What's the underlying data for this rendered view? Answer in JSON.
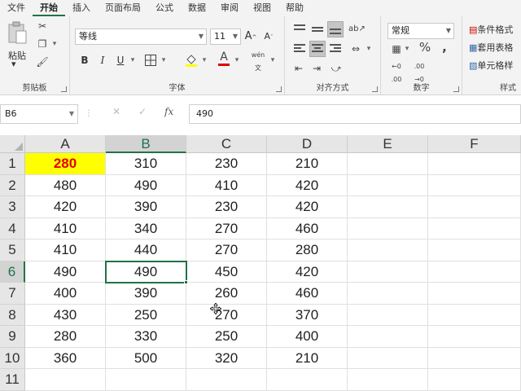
{
  "menu": {
    "tabs": [
      "文件",
      "开始",
      "插入",
      "页面布局",
      "公式",
      "数据",
      "审阅",
      "视图",
      "帮助"
    ],
    "active_index": 1
  },
  "ribbon": {
    "clipboard": {
      "label": "剪贴板",
      "paste_label": "粘贴"
    },
    "font": {
      "label": "字体",
      "font_name": "等线",
      "font_size": "11",
      "grow": "A",
      "shrink": "A",
      "bold": "B",
      "italic": "I",
      "underline": "U",
      "phonetic": "wén"
    },
    "alignment": {
      "label": "对齐方式"
    },
    "number": {
      "label": "数字",
      "format": "常规",
      "percent": "%"
    },
    "styles": {
      "label": "样式",
      "conditional": "条件格式",
      "table": "套用表格",
      "cell": "单元格样"
    }
  },
  "formula_bar": {
    "name_box": "B6",
    "fx": "fx",
    "formula": "490"
  },
  "sheet": {
    "columns": [
      "A",
      "B",
      "C",
      "D",
      "E",
      "F"
    ],
    "rows": [
      [
        "280",
        "310",
        "230",
        "210",
        "",
        ""
      ],
      [
        "480",
        "490",
        "410",
        "420",
        "",
        ""
      ],
      [
        "420",
        "390",
        "230",
        "420",
        "",
        ""
      ],
      [
        "410",
        "340",
        "270",
        "460",
        "",
        ""
      ],
      [
        "410",
        "440",
        "270",
        "280",
        "",
        ""
      ],
      [
        "490",
        "490",
        "450",
        "420",
        "",
        ""
      ],
      [
        "400",
        "390",
        "260",
        "460",
        "",
        ""
      ],
      [
        "430",
        "250",
        "270",
        "370",
        "",
        ""
      ],
      [
        "280",
        "330",
        "250",
        "400",
        "",
        ""
      ],
      [
        "360",
        "500",
        "320",
        "210",
        "",
        ""
      ],
      [
        "",
        "",
        "",
        "",
        "",
        ""
      ]
    ],
    "active_cell": "B6",
    "highlight_cell": "A1",
    "highlight_colors": {
      "fill": "#ffff00",
      "text": "#e00000"
    },
    "accent": "#217346"
  }
}
